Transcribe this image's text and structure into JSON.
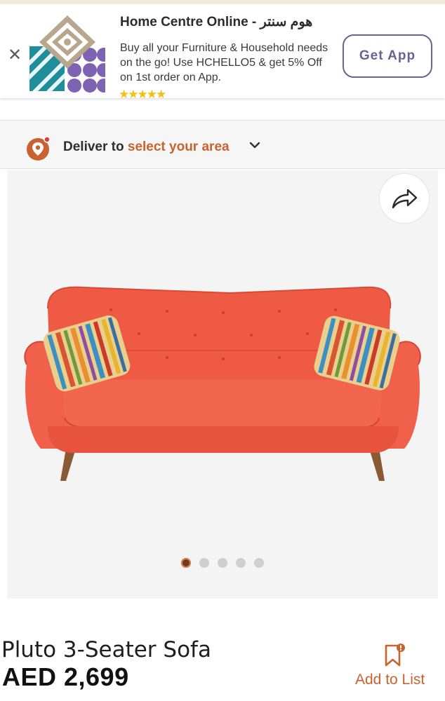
{
  "banner": {
    "close_icon": "close-icon",
    "app_name": "Home Centre Online - هوم سنتر",
    "description": "Buy all your Furniture & Household needs on the go! Use HCHELLO5 & get 5% Off on 1st order on App.",
    "rating_stars": "★★★★★",
    "get_app_label": "Get App"
  },
  "delivery": {
    "prefix": "Deliver to ",
    "area_link": "select your area"
  },
  "gallery": {
    "share_icon": "share-icon",
    "image_count": 5,
    "active_index": 0
  },
  "product": {
    "name": "Pluto 3-Seater Sofa",
    "price": "AED 2,699",
    "add_to_list_label": "Add to List"
  },
  "colors": {
    "accent": "#c9622e",
    "get_app": "#6a6292",
    "sofa": "#ef5a44",
    "stars": "#f2c010"
  }
}
